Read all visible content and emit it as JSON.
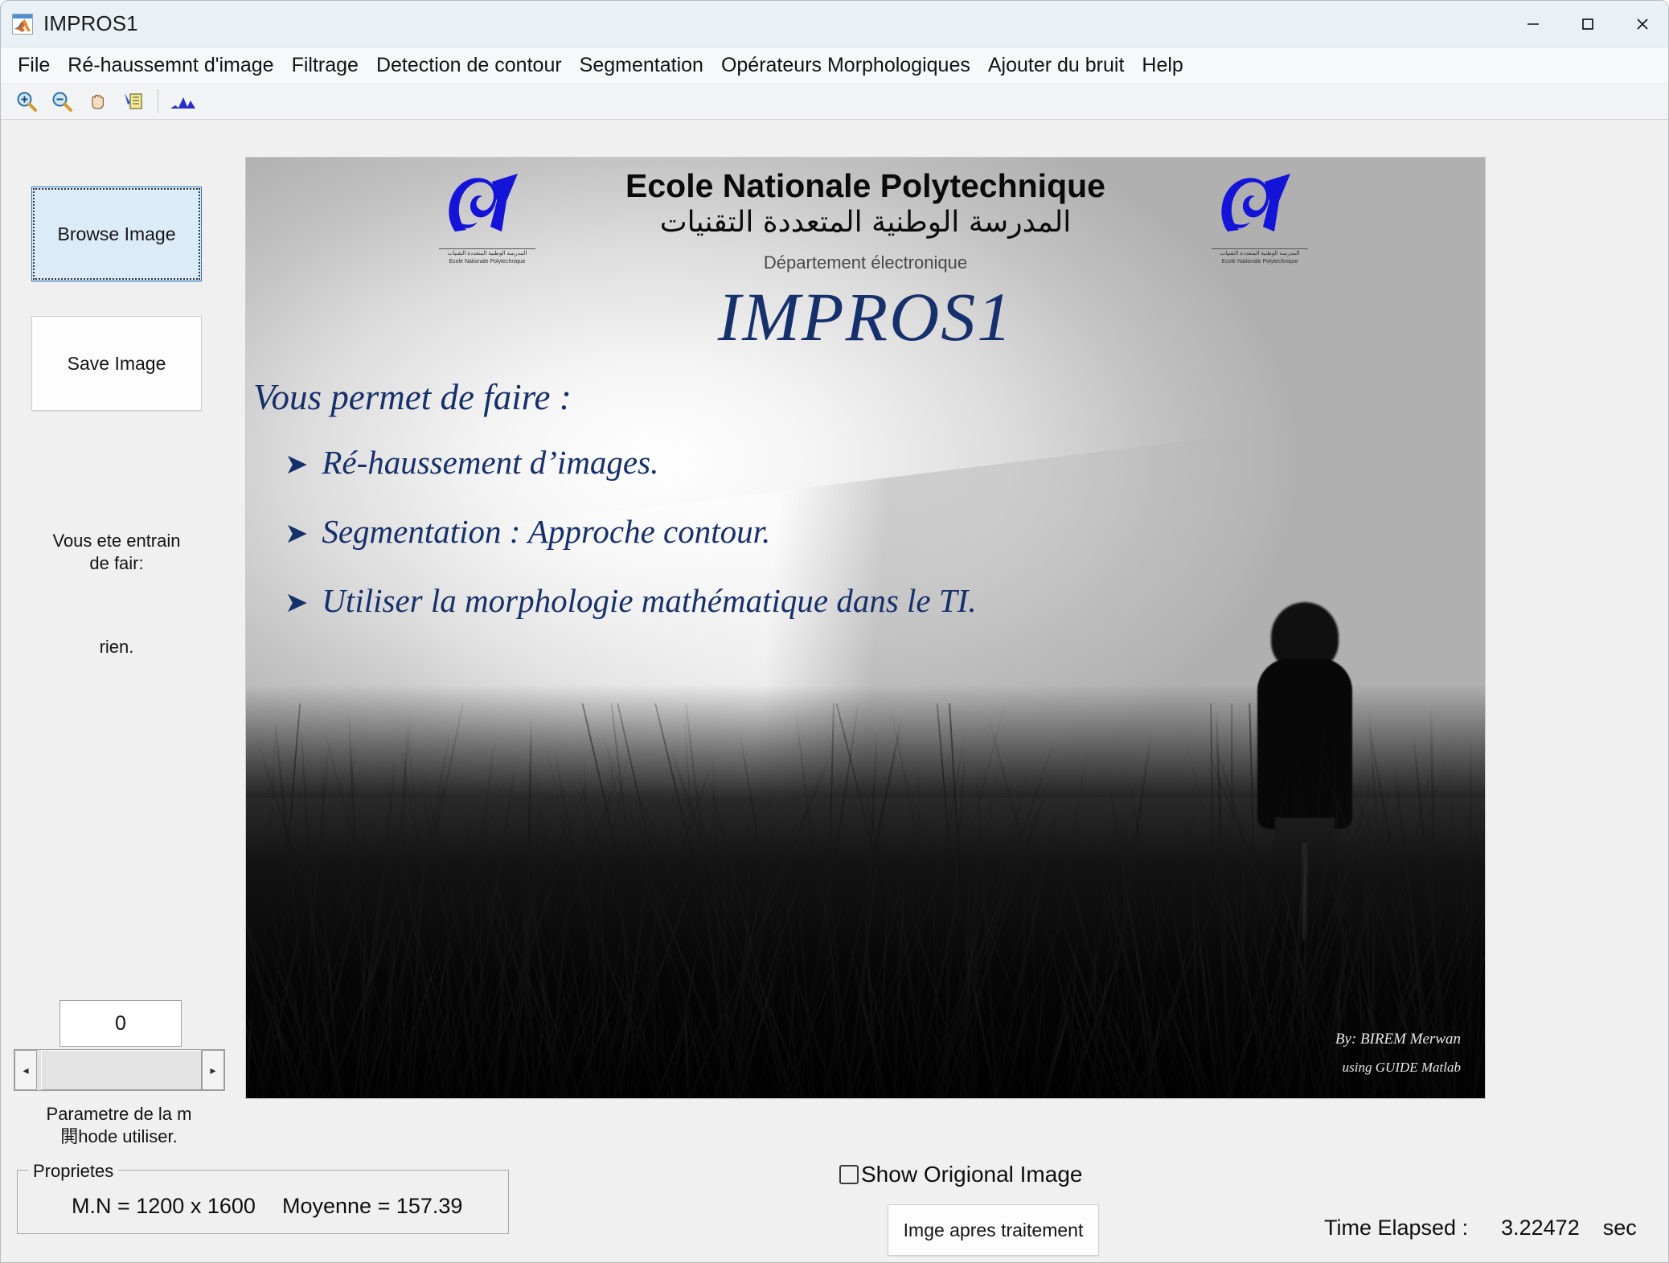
{
  "window": {
    "title": "IMPROS1",
    "icon": "matlab-icon",
    "minimize": "─",
    "maximize": "□",
    "close": "✕"
  },
  "menubar": {
    "items": [
      {
        "label": "File",
        "name": "menu-file"
      },
      {
        "label": "Ré-haussemnt d'image",
        "name": "menu-rehaussement"
      },
      {
        "label": "Filtrage",
        "name": "menu-filtrage"
      },
      {
        "label": "Detection de contour",
        "name": "menu-detection-contour"
      },
      {
        "label": "Segmentation",
        "name": "menu-segmentation"
      },
      {
        "label": "Opérateurs Morphologiques",
        "name": "menu-operateurs-morphologiques"
      },
      {
        "label": "Ajouter du bruit",
        "name": "menu-ajouter-bruit"
      },
      {
        "label": "Help",
        "name": "menu-help"
      }
    ]
  },
  "toolbar": {
    "items": [
      {
        "name": "zoom-in-icon",
        "title": "Zoom In"
      },
      {
        "name": "zoom-out-icon",
        "title": "Zoom Out"
      },
      {
        "name": "pan-hand-icon",
        "title": "Pan"
      },
      {
        "name": "data-cursor-icon",
        "title": "Data Cursor"
      },
      {
        "name": "histogram-icon",
        "title": "Insert Legend"
      }
    ]
  },
  "controls": {
    "browse_image_label": "Browse Image",
    "save_image_label": "Save Image",
    "doing_label": "Vous ete entrain\nde fair:",
    "doing_value": "rien.",
    "param_value": "0",
    "param_caption": "Parametre de la m\n閧hode utiliser.",
    "slider_left_arrow": "◂",
    "slider_right_arrow": "▸"
  },
  "proprietes": {
    "title": "Proprietes",
    "mn_text": "M.N =  1200 x   1600",
    "moyenne_text": "Moyenne = 157.39"
  },
  "bottom": {
    "show_original_label": "Show Origional Image",
    "show_original_checked": false,
    "apres_traitement_label": "Imge apres traitement",
    "time_elapsed_label": "Time Elapsed :",
    "time_elapsed_value": "3.22472",
    "time_elapsed_unit": "sec"
  },
  "image": {
    "school_name": "Ecole Nationale Polytechnique",
    "school_name_arabic": "المدرسة الوطنية المتعددة التقنيات",
    "department": "Département électronique",
    "big_title": "IMPROS1",
    "lead_line": "Vous permet de faire :",
    "logo_caption_ar": "المدرسة الوطنية المتعددة التقنيات",
    "logo_caption_fr": "Ecole Nationale Polytechnique",
    "bullet_mark": "➤",
    "bullets": [
      "Ré-haussement d’images.",
      "Segmentation : Approche contour.",
      "Utiliser la morphologie mathématique dans le TI."
    ],
    "signature_author": "By: BIREM Merwan",
    "signature_tool": "using GUIDE Matlab"
  },
  "colors": {
    "accent_blue": "#16306b",
    "logo_blue": "#1414d8",
    "window_bg": "#f0f0f0",
    "titlebar_bg": "#eaf1f6",
    "focus_button_bg": "#dcebf8"
  }
}
